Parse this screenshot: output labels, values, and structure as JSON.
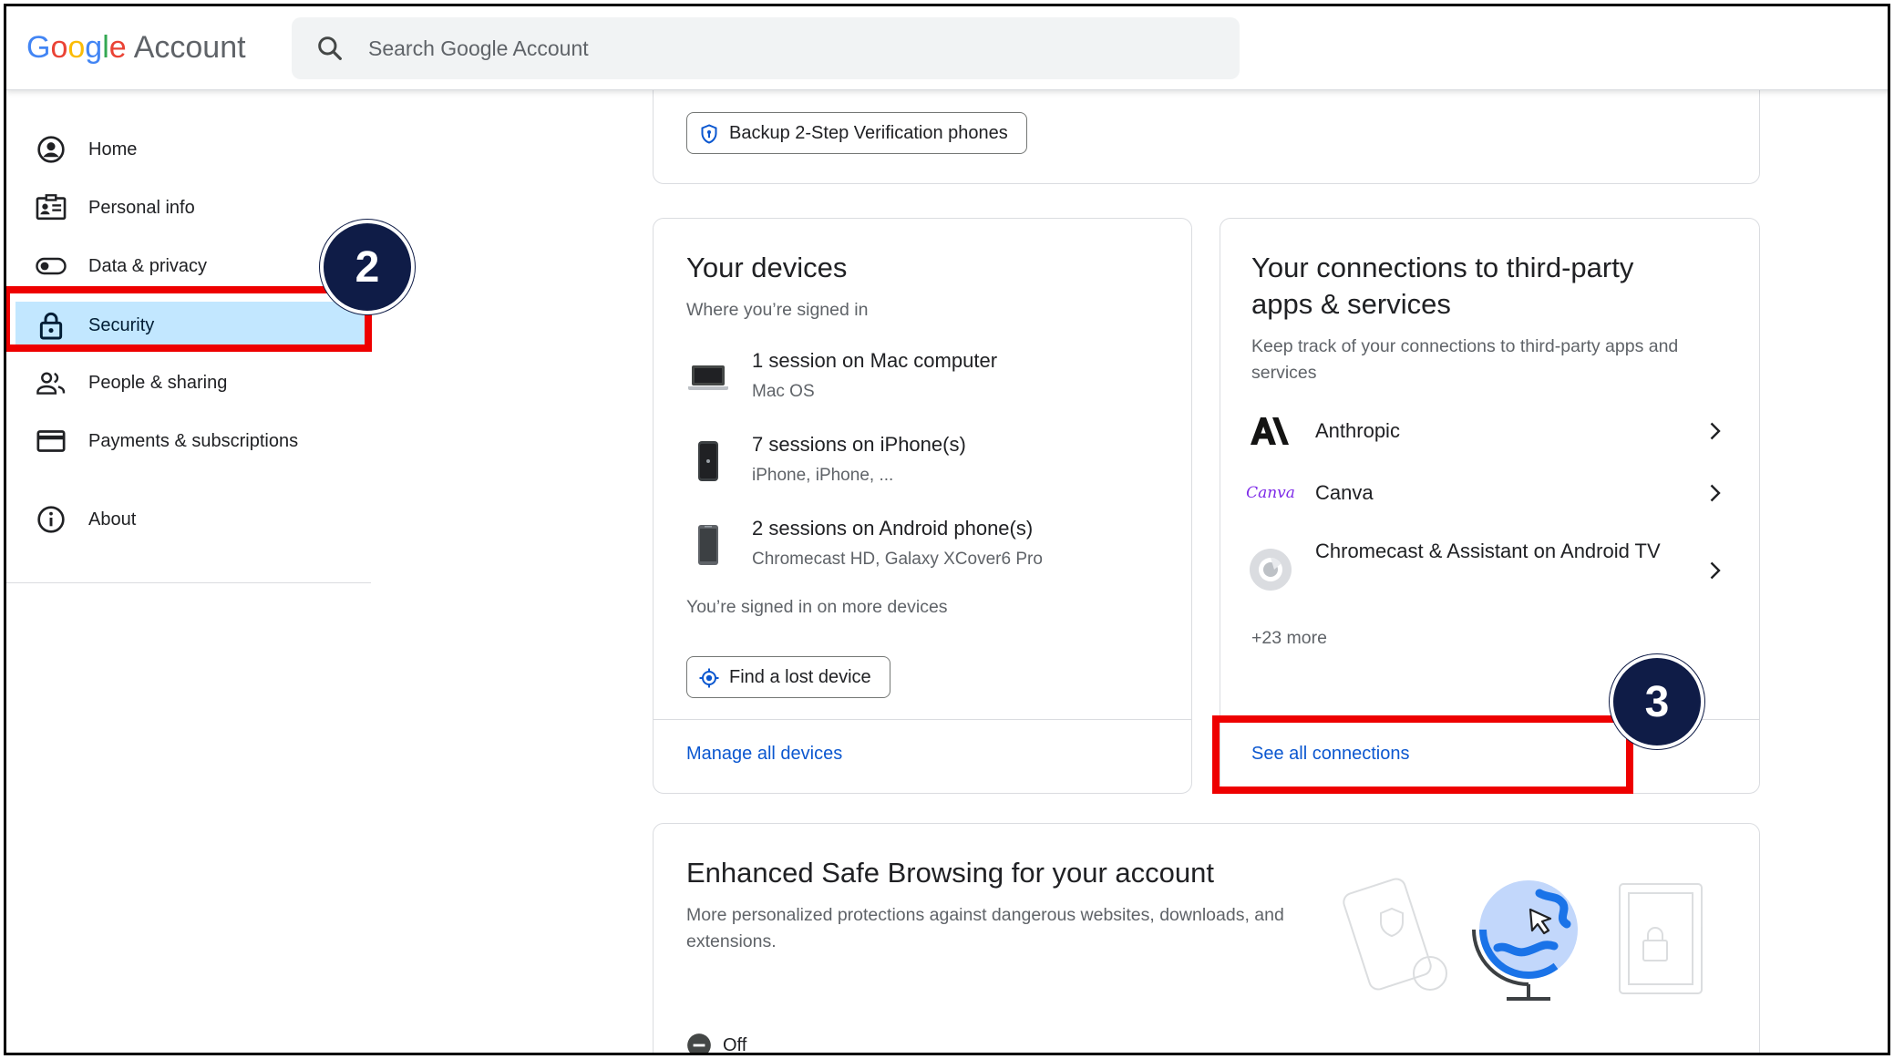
{
  "header": {
    "logo_letters": [
      "G",
      "o",
      "o",
      "g",
      "l",
      "e"
    ],
    "logo_suffix": "Account",
    "search_placeholder": "Search Google Account"
  },
  "sidebar": {
    "items": [
      {
        "label": "Home",
        "icon": "account-circle-icon"
      },
      {
        "label": "Personal info",
        "icon": "id-card-icon"
      },
      {
        "label": "Data & privacy",
        "icon": "toggle-icon"
      },
      {
        "label": "Security",
        "icon": "lock-icon",
        "active": true
      },
      {
        "label": "People & sharing",
        "icon": "people-icon"
      },
      {
        "label": "Payments & subscriptions",
        "icon": "credit-card-icon"
      }
    ],
    "about": {
      "label": "About",
      "icon": "info-icon"
    }
  },
  "top_card": {
    "button_label": "Backup 2-Step Verification phones"
  },
  "devices": {
    "title": "Your devices",
    "subtitle": "Where you’re signed in",
    "rows": [
      {
        "title": "1 session on Mac computer",
        "sub": "Mac OS",
        "icon": "laptop-icon"
      },
      {
        "title": "7 sessions on iPhone(s)",
        "sub": "iPhone, iPhone, ...",
        "icon": "iphone-icon"
      },
      {
        "title": "2 sessions on Android phone(s)",
        "sub": "Chromecast HD, Galaxy XCover6 Pro",
        "icon": "android-phone-icon"
      }
    ],
    "more_text": "You’re signed in on more devices",
    "find_button": "Find a lost device",
    "footer_link": "Manage all devices"
  },
  "connections": {
    "title_line1": "Your connections to third-party",
    "title_line2": "apps & services",
    "subtitle": "Keep track of your connections to third-party apps and services",
    "rows": [
      {
        "label": "Anthropic",
        "icon": "anthropic-logo-icon"
      },
      {
        "label": "Canva",
        "icon": "canva-logo-icon",
        "logo_text": "Canva"
      },
      {
        "label": "Chromecast & Assistant on Android TV",
        "icon": "chromecast-logo-icon"
      }
    ],
    "more_text": "+23 more",
    "footer_link": "See all connections"
  },
  "safe_browsing": {
    "title": "Enhanced Safe Browsing for your account",
    "subtitle": "More personalized protections against dangerous websites, downloads, and extensions.",
    "status": "Off"
  },
  "annotations": {
    "badge_security": "2",
    "badge_connections": "3",
    "highlight_color": "#ee0000",
    "badge_color": "#0f1c47"
  },
  "colors": {
    "link": "#0b57d0",
    "active_nav": "#c2e7ff"
  }
}
